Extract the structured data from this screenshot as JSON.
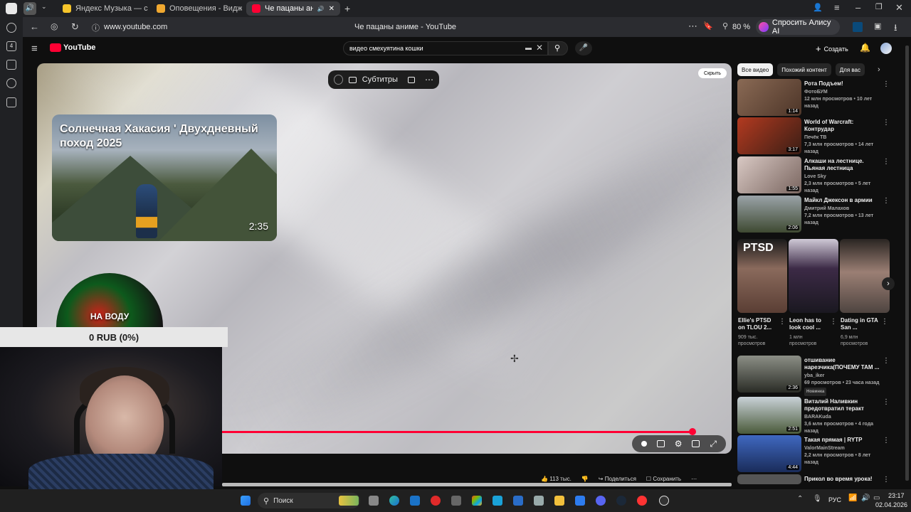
{
  "browser": {
    "tabs": [
      {
        "label": "Яндекс Музыка — собир"
      },
      {
        "label": "Оповещения - Виджеты"
      },
      {
        "label": "Че пацаны аниме - "
      }
    ],
    "url": "www.youtube.com",
    "page_title": "Че пацаны аниме - YouTube",
    "zoom": "80 %",
    "alice_label": "Спросить Алису AI",
    "sidebar_badge": "4"
  },
  "youtube": {
    "logo": "YouTube",
    "search_value": "видео  смехуятина кошки",
    "create_label": "Создать"
  },
  "player": {
    "subtitles_label": "Субтитры",
    "hide_label": "Скрыть",
    "overlay_title": "Солнечная Хакасия ' Двухдневный поход 2025",
    "overlay_duration": "2:35",
    "likes": "113 тыс.",
    "share_label": "Поделиться",
    "save_label": "Сохранить"
  },
  "stream_overlay": {
    "circle_text": "НА ВОДУ",
    "rub_text": "0 RUB (0%)"
  },
  "chips": [
    "Все видео",
    "Похожий контент",
    "Для вас"
  ],
  "related": [
    {
      "title": "Рота Подъем!",
      "channel": "ФотоБУМ",
      "meta": "12 млн просмотров • 10 лет назад",
      "duration": "1:14",
      "color": "#6b4a38"
    },
    {
      "title": "World of Warcraft: Контрудар",
      "channel": "Печёк ТВ",
      "meta": "7,3 млн просмотров • 14 лет назад",
      "duration": "3:17",
      "color": "#8a2a1a"
    },
    {
      "title": "Алкаши на лестнице. Пьяная лестница",
      "channel": "Love Sky",
      "meta": "2,3 млн просмотров • 5 лет назад",
      "duration": "1:55",
      "color": "#b9a7a2"
    },
    {
      "title": "Майкл Джексон в армии",
      "channel": "Дмитрий Малахов",
      "meta": "7,2 млн просмотров • 13 лет назад",
      "duration": "2:06",
      "color": "#4d5a3a"
    }
  ],
  "shorts": [
    {
      "title": "Ellie's PTSD on TLOU 2...",
      "meta": "909 тыс. просмотров",
      "thumb_text": "PTSD",
      "color": "#6e5346"
    },
    {
      "title": "Leon has to look cool ...",
      "meta": "1 млн просмотров",
      "thumb_text": "",
      "color": "#2e2233"
    },
    {
      "title": "Dating in GTA San ...",
      "meta": "6,9 млн просмотров",
      "thumb_text": "",
      "color": "#5d524f"
    }
  ],
  "related2": [
    {
      "title": "отшивание нарезчика(ПОЧЕМУ ТАМ ...",
      "channel": "yba_iker",
      "meta": "69 просмотров • 23 часа назад",
      "badge": "Новинка",
      "duration": "2:36",
      "color": "#3a3d35"
    },
    {
      "title": "Виталий Наливкин предотвратил теракт",
      "channel": "BARAKuda",
      "meta": "3,6 млн просмотров • 4 года назад",
      "badge": "",
      "duration": "2:51",
      "color": "#56614a"
    },
    {
      "title": "Такая прямая | RYTP",
      "channel": "ValorMainStream",
      "meta": "2,2 млн просмотров • 8 лет назад",
      "badge": "",
      "duration": "4:44",
      "color": "#2f4f9a"
    },
    {
      "title": "Прикол во время урока!",
      "channel": "",
      "meta": "",
      "badge": "",
      "duration": "",
      "color": "#444"
    }
  ],
  "taskbar": {
    "search_label": "Поиск",
    "lang": "РУС",
    "time": "23:17",
    "date": "02.04.2026"
  }
}
